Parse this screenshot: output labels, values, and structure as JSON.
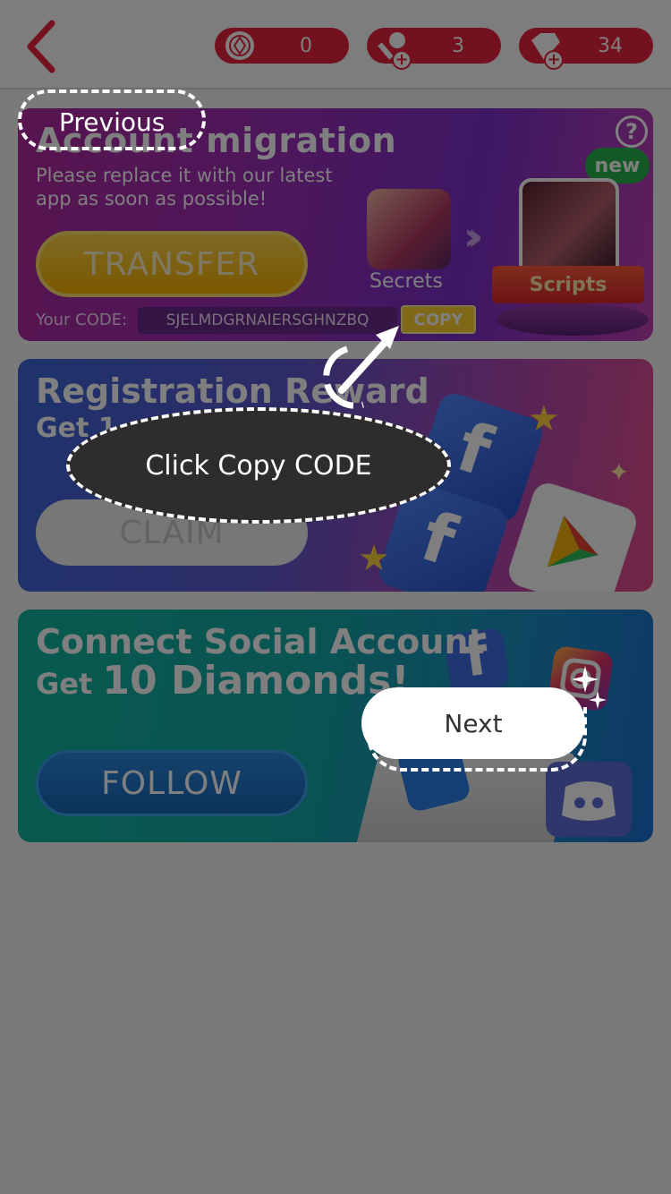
{
  "header": {
    "currencies": [
      {
        "name": "tickets",
        "value": "0"
      },
      {
        "name": "keys",
        "value": "3"
      },
      {
        "name": "diamonds",
        "value": "34"
      }
    ]
  },
  "migration": {
    "title": "Account migration",
    "subtitle": "Please replace it with our latest app as soon as possible!",
    "transfer_label": "TRANSFER",
    "code_label": "Your CODE:",
    "code_value": "SJELMDGRNAIERSGHNZBQ",
    "copy_label": "COPY",
    "help": "?",
    "new_badge": "new",
    "secrets_label": "Secrets",
    "scripts_label": "Scripts"
  },
  "registration": {
    "title": "Registration Reward",
    "subtitle": "Get 1",
    "claim_label": "CLAIM"
  },
  "social": {
    "title": "Connect Social Account",
    "subtitle_prefix": "Get ",
    "subtitle_main": "10 Diamonds!",
    "follow_label": "FOLLOW"
  },
  "tutorial": {
    "previous_label": "Previous",
    "bubble_text": "Click Copy CODE",
    "next_label": "Next"
  },
  "colors": {
    "accent_red": "#e7233c",
    "gold": "#ffd12e",
    "overlay": "rgba(0,0,0,0.5)"
  }
}
